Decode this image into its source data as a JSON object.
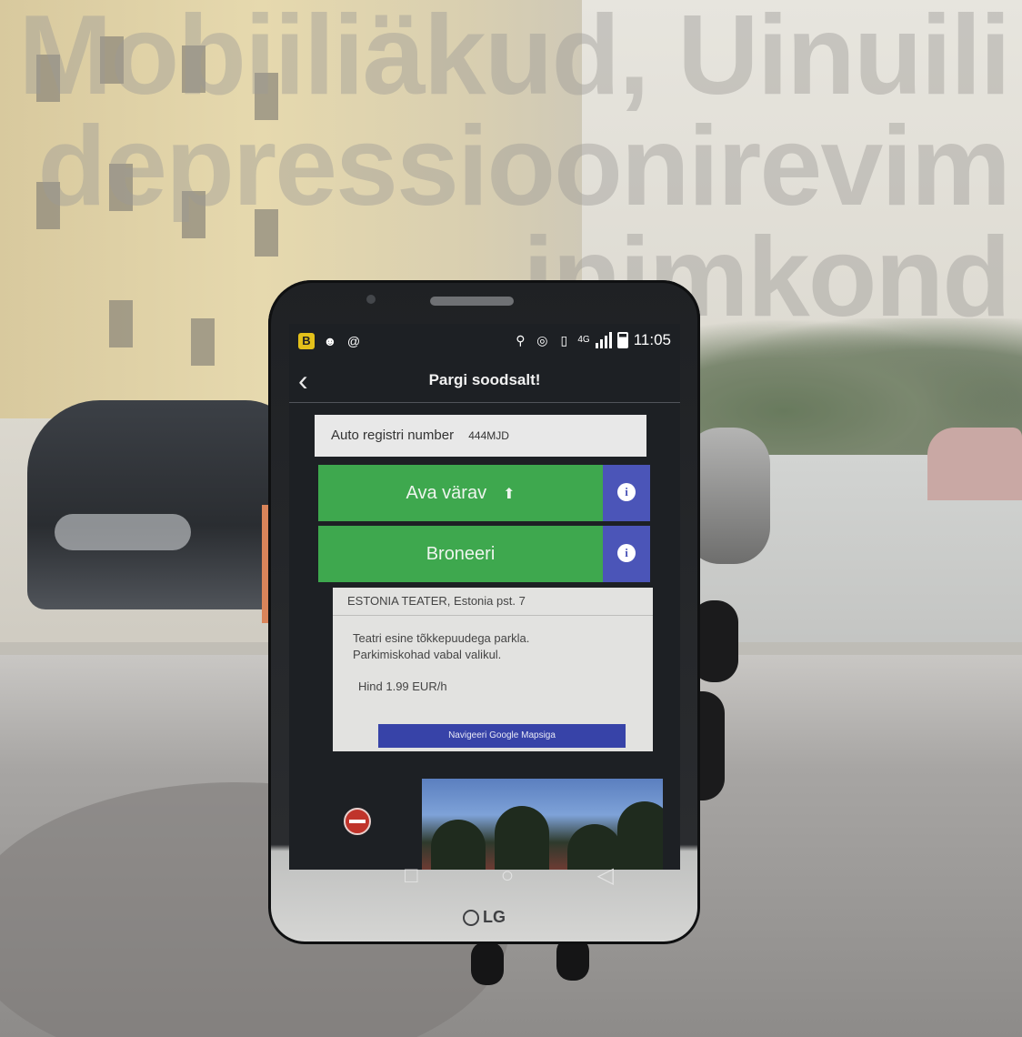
{
  "headline": {
    "lines": [
      "Mobiiliäkud, Uinuili",
      "depressioonirevim",
      "inimkond"
    ]
  },
  "phone": {
    "brand": "LG",
    "statusbar": {
      "left_badge": "B",
      "network": "4G",
      "time": "11:05"
    },
    "app": {
      "back_icon": "chevron-left-icon",
      "title": "Pargi soodsalt!",
      "registration": {
        "label": "Auto registri number",
        "value": "444MJD"
      },
      "buttons": [
        {
          "label": "Ava värav",
          "color": "#3ea84e",
          "info_color": "#4b55b8"
        },
        {
          "label": "Broneeri",
          "color": "#3ea84e",
          "info_color": "#4b55b8"
        }
      ],
      "info_symbol": "i",
      "parking": {
        "location": "ESTONIA TEATER, Estonia pst. 7",
        "description_line1": "Teatri esine tõkkepuudega parkla.",
        "description_line2": "Parkimiskohad vabal valikul.",
        "price": "Hind 1.99 EUR/h",
        "navigate_label": "Navigeeri Google Mapsiga"
      }
    },
    "navbar_icons": [
      "square-icon",
      "circle-home-icon",
      "triangle-back-icon"
    ]
  }
}
